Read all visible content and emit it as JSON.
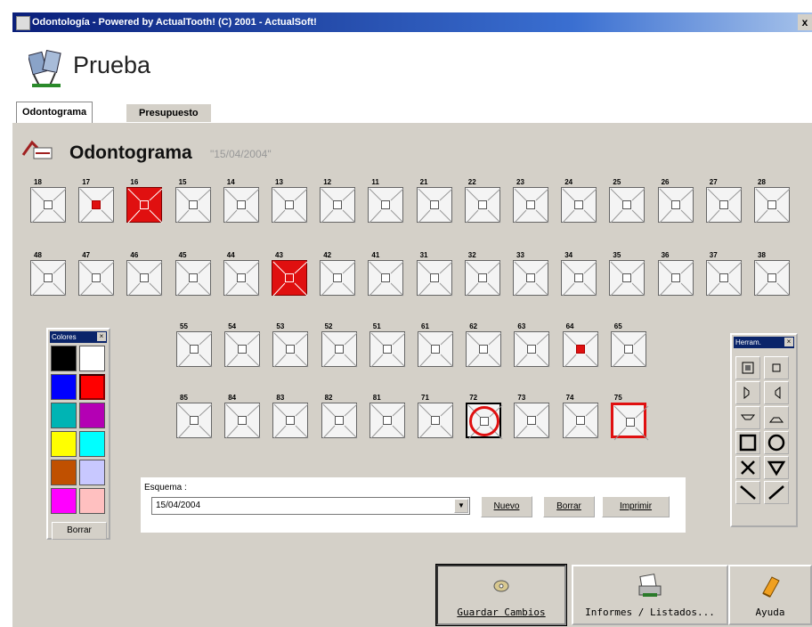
{
  "window": {
    "title": "Odontología - Powered by ActualTooth! (C) 2001 - ActualSoft!",
    "close_label": "x"
  },
  "header": {
    "patient_name": "Prueba"
  },
  "tabs": [
    {
      "label": "Odontograma"
    },
    {
      "label": "Presupuesto"
    }
  ],
  "section": {
    "title": "Odontograma",
    "date": "\"15/04/2004\""
  },
  "teeth_rows": [
    [
      {
        "n": "18",
        "s": "normal"
      },
      {
        "n": "17",
        "s": "center-red"
      },
      {
        "n": "16",
        "s": "full-red"
      },
      {
        "n": "15",
        "s": "normal"
      },
      {
        "n": "14",
        "s": "normal"
      },
      {
        "n": "13",
        "s": "normal"
      },
      {
        "n": "12",
        "s": "normal"
      },
      {
        "n": "11",
        "s": "normal"
      },
      {
        "n": "21",
        "s": "normal"
      },
      {
        "n": "22",
        "s": "normal"
      },
      {
        "n": "23",
        "s": "normal"
      },
      {
        "n": "24",
        "s": "normal"
      },
      {
        "n": "25",
        "s": "normal"
      },
      {
        "n": "26",
        "s": "normal"
      },
      {
        "n": "27",
        "s": "normal"
      },
      {
        "n": "28",
        "s": "normal"
      }
    ],
    [
      {
        "n": "48",
        "s": "normal"
      },
      {
        "n": "47",
        "s": "normal"
      },
      {
        "n": "46",
        "s": "normal"
      },
      {
        "n": "45",
        "s": "normal"
      },
      {
        "n": "44",
        "s": "normal"
      },
      {
        "n": "43",
        "s": "full-red"
      },
      {
        "n": "42",
        "s": "normal"
      },
      {
        "n": "41",
        "s": "normal"
      },
      {
        "n": "31",
        "s": "normal"
      },
      {
        "n": "32",
        "s": "normal"
      },
      {
        "n": "33",
        "s": "normal"
      },
      {
        "n": "34",
        "s": "normal"
      },
      {
        "n": "35",
        "s": "normal"
      },
      {
        "n": "36",
        "s": "normal"
      },
      {
        "n": "37",
        "s": "normal"
      },
      {
        "n": "38",
        "s": "normal"
      }
    ],
    [
      {
        "n": "55",
        "s": "normal"
      },
      {
        "n": "54",
        "s": "normal"
      },
      {
        "n": "53",
        "s": "normal"
      },
      {
        "n": "52",
        "s": "normal"
      },
      {
        "n": "51",
        "s": "normal"
      },
      {
        "n": "61",
        "s": "normal"
      },
      {
        "n": "62",
        "s": "normal"
      },
      {
        "n": "63",
        "s": "normal"
      },
      {
        "n": "64",
        "s": "center-red"
      },
      {
        "n": "65",
        "s": "normal"
      }
    ],
    [
      {
        "n": "85",
        "s": "normal"
      },
      {
        "n": "84",
        "s": "normal"
      },
      {
        "n": "83",
        "s": "normal"
      },
      {
        "n": "82",
        "s": "normal"
      },
      {
        "n": "81",
        "s": "normal"
      },
      {
        "n": "71",
        "s": "normal"
      },
      {
        "n": "72",
        "s": "circle"
      },
      {
        "n": "73",
        "s": "normal"
      },
      {
        "n": "74",
        "s": "normal"
      },
      {
        "n": "75",
        "s": "red-border"
      }
    ]
  ],
  "palette": {
    "title": "Colores",
    "colors": [
      "#000000",
      "#ffffff",
      "#0000ff",
      "#ff0000",
      "#00b4b4",
      "#b400b4",
      "#ffff00",
      "#00ffff",
      "#c05000",
      "#c8c8ff",
      "#ff00ff",
      "#ffc0c0"
    ],
    "clear_label": "Borrar"
  },
  "scheme": {
    "label": "Esquema :",
    "value": "15/04/2004",
    "buttons": {
      "new": "Nuevo",
      "delete": "Borrar",
      "print": "Imprimir"
    }
  },
  "tools": {
    "title": "Herram."
  },
  "bottom_buttons": {
    "save": "Guardar Cambios",
    "reports": "Informes / Listados...",
    "help": "Ayuda"
  }
}
